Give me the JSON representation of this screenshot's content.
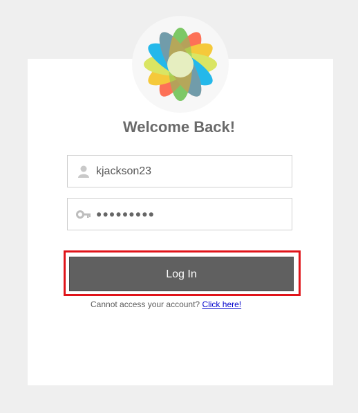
{
  "login": {
    "title": "Welcome Back!",
    "username_value": "kjackson23",
    "password_masked": "●●●●●●●●●",
    "login_button": "Log In",
    "help_text": "Cannot access your account?",
    "help_link": "Click here!"
  },
  "icons": {
    "logo": "atom-flower-logo",
    "username": "user-icon",
    "password": "key-icon"
  },
  "colors": {
    "background": "#efefef",
    "card": "#ffffff",
    "button": "#606060",
    "highlight": "#e0141a",
    "link": "#0000cc",
    "title": "#6a6a6a"
  }
}
